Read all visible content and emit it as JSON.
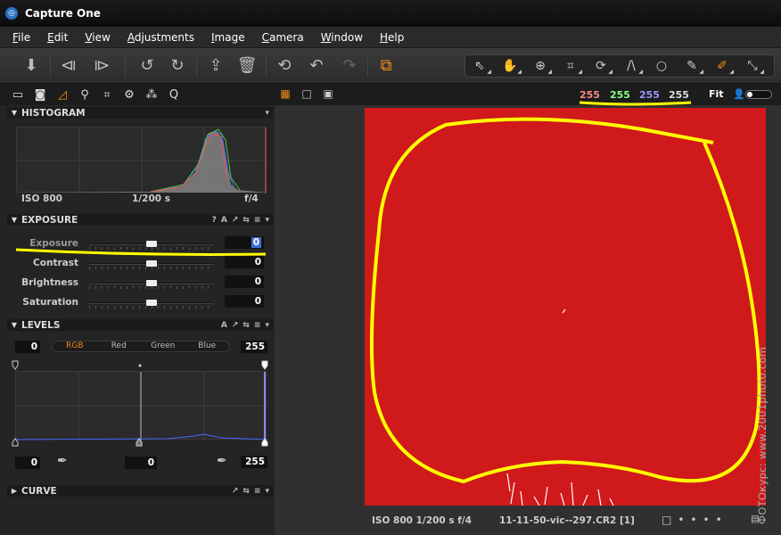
{
  "window": {
    "title": "Capture One"
  },
  "menu": [
    "File",
    "Edit",
    "View",
    "Adjustments",
    "Image",
    "Camera",
    "Window",
    "Help"
  ],
  "toolbar_icons": [
    "import-icon",
    "previous-icon",
    "next-icon",
    "rotate-left-icon",
    "rotate-right-icon",
    "move-to-folder-icon",
    "delete-icon",
    "undo-icon",
    "undo-step-icon",
    "redo-icon",
    "process-icon"
  ],
  "cursor_tools": [
    "select-icon",
    "pan-icon",
    "zoom-icon",
    "crop-icon",
    "rotate-icon",
    "keystone-icon",
    "spot-remove-icon",
    "local-brush-icon",
    "color-picker-icon",
    "white-balance-icon"
  ],
  "tool_tabs": [
    "library-icon",
    "capture-icon",
    "adjust-icon",
    "focus-icon",
    "lens-icon",
    "settings-icon",
    "metadata-icon",
    "quick-icon"
  ],
  "histogram": {
    "title": "HISTOGRAM",
    "iso": "ISO 800",
    "shutter": "1/200 s",
    "aperture": "f/4"
  },
  "exposure": {
    "title": "EXPOSURE",
    "controls": [
      "?",
      "A",
      "↗",
      "⇆",
      "≡",
      "▾"
    ],
    "sliders": [
      {
        "label": "Exposure",
        "value": "0",
        "position": 0.5
      },
      {
        "label": "Contrast",
        "value": "0",
        "position": 0.5
      },
      {
        "label": "Brightness",
        "value": "0",
        "position": 0.5
      },
      {
        "label": "Saturation",
        "value": "0",
        "position": 0.5
      }
    ]
  },
  "levels": {
    "title": "LEVELS",
    "controls": [
      "A",
      "↗",
      "⇆",
      "≡",
      "▾"
    ],
    "input_low": "0",
    "input_high": "255",
    "channels": [
      "RGB",
      "Red",
      "Green",
      "Blue"
    ],
    "active_channel": "RGB",
    "output_low": "0",
    "output_mid": "0",
    "output_high": "255"
  },
  "curve": {
    "title": "CURVE",
    "controls": [
      "↗",
      "⇆",
      "≡",
      "▾"
    ]
  },
  "viewer": {
    "readout": [
      {
        "value": "255",
        "color": "#ff8888"
      },
      {
        "value": "255",
        "color": "#88ff88"
      },
      {
        "value": "255",
        "color": "#9999ff"
      },
      {
        "value": "255",
        "color": "#dddddd"
      }
    ],
    "fit_label": "Fit",
    "image_color": "#d0191b",
    "status_exposure": "ISO 800 1/200 s f/4",
    "status_filename": "11-11-50-vic--297.CR2 [1]"
  },
  "watermark": "ФОТОкурс: www.2001photo.com",
  "annotation_color": "#ffff00"
}
